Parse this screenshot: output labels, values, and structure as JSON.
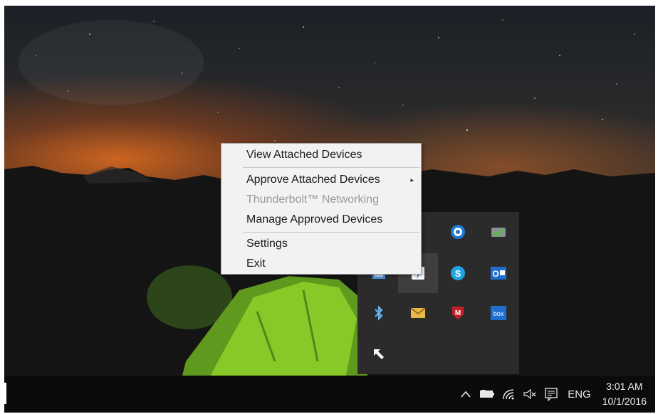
{
  "context_menu": {
    "items": [
      {
        "label": "View Attached Devices",
        "enabled": true,
        "submenu": false
      },
      {
        "label": "Approve Attached Devices",
        "enabled": true,
        "submenu": true
      },
      {
        "label": "Thunderbolt™ Networking",
        "enabled": false,
        "submenu": false
      },
      {
        "label": "Manage Approved Devices",
        "enabled": true,
        "submenu": false
      },
      {
        "label": "Settings",
        "enabled": true,
        "submenu": false
      },
      {
        "label": "Exit",
        "enabled": true,
        "submenu": false
      }
    ],
    "submenu_arrow": "▸"
  },
  "tray_flyout": {
    "icons": [
      {
        "name": "red-app-icon"
      },
      {
        "name": "blue-app-icon"
      },
      {
        "name": "sync-check-icon"
      },
      {
        "name": "network-app-icon"
      },
      {
        "name": "thunderbolt-icon"
      },
      {
        "name": "skype-icon"
      },
      {
        "name": "outlook-icon"
      },
      {
        "name": "bluetooth-icon"
      },
      {
        "name": "mail-icon"
      },
      {
        "name": "mcafee-icon"
      },
      {
        "name": "box-icon"
      },
      {
        "name": "cursor-app-icon"
      }
    ],
    "box_label": "box",
    "outlook_label": "O"
  },
  "taskbar": {
    "tray_icons": [
      "show-hidden-icons-chevron-icon",
      "battery-icon",
      "wifi-icon",
      "volume-muted-icon",
      "action-center-icon"
    ],
    "language": "ENG",
    "time": "3:01 AM",
    "date": "10/1/2016"
  },
  "colors": {
    "menu_background": "#f2f2f2",
    "taskbar": "#0b0b0c",
    "flyout": "#2b2b2c",
    "accent_blue": "#1f6fd0"
  }
}
